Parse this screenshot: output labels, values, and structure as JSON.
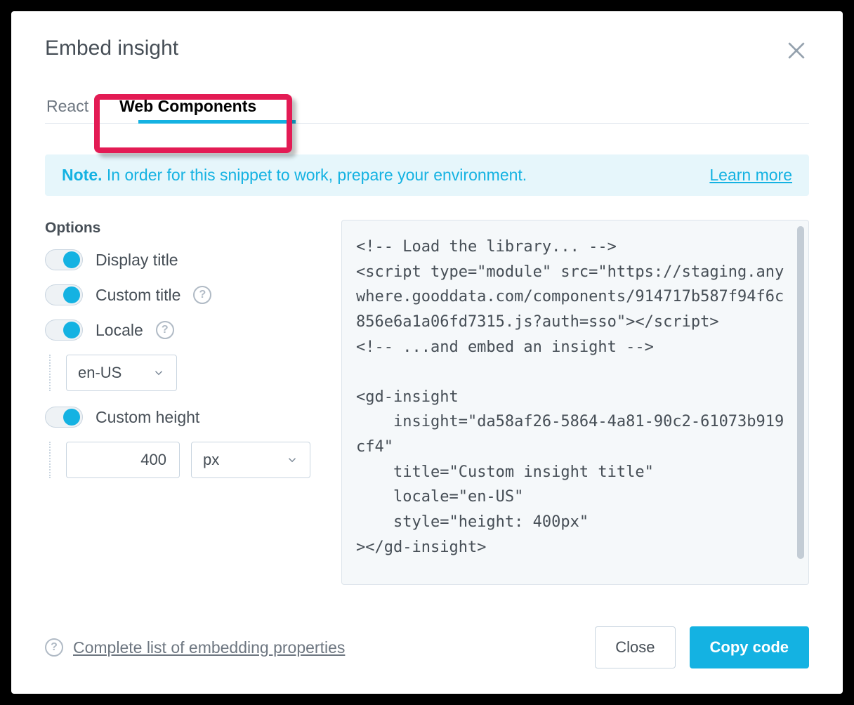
{
  "dialog": {
    "title": "Embed insight"
  },
  "tabs": {
    "react": "React",
    "web_components": "Web Components",
    "active": "web_components"
  },
  "highlight": {
    "target_tab": "web_components"
  },
  "note": {
    "label": "Note.",
    "text": " In order for this snippet to work, prepare your environment.",
    "learn_more": "Learn more"
  },
  "options": {
    "heading": "Options",
    "display_title": {
      "label": "Display title",
      "on": true
    },
    "custom_title": {
      "label": "Custom title",
      "on": true
    },
    "locale": {
      "label": "Locale",
      "on": true,
      "value": "en-US"
    },
    "custom_height": {
      "label": "Custom height",
      "on": true,
      "value": "400",
      "unit": "px"
    }
  },
  "code_snippet": "<!-- Load the library... -->\n<script type=\"module\" src=\"https://staging.anywhere.gooddata.com/components/914717b587f94f6c856e6a1a06fd7315.js?auth=sso\"></script>\n<!-- ...and embed an insight -->\n\n<gd-insight\n    insight=\"da58af26-5864-4a81-90c2-61073b919cf4\"\n    title=\"Custom insight title\"\n    locale=\"en-US\"\n    style=\"height: 400px\"\n></gd-insight>",
  "footer": {
    "link": "Complete list of embedding properties",
    "close": "Close",
    "copy": "Copy code"
  }
}
